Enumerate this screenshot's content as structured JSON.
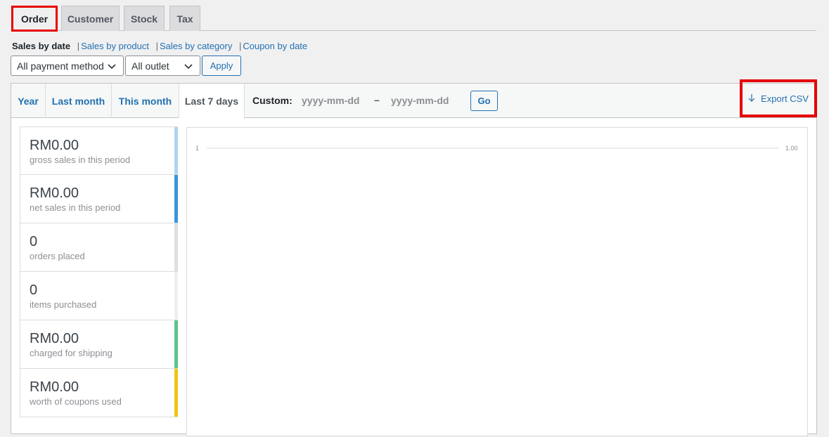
{
  "report_tabs": [
    {
      "label": "Order",
      "active": true
    },
    {
      "label": "Customer"
    },
    {
      "label": "Stock"
    },
    {
      "label": "Tax"
    }
  ],
  "sub_nav": {
    "current": "Sales by date",
    "links": [
      "Sales by product",
      "Sales by category",
      "Coupon by date"
    ]
  },
  "filters": {
    "payment_method": "All payment method",
    "outlet": "All outlet",
    "apply_label": "Apply"
  },
  "range": {
    "items": [
      "Year",
      "Last month",
      "This month",
      "Last 7 days"
    ],
    "active": "Last 7 days",
    "custom_label": "Custom:",
    "date_placeholder": "yyyy-mm-dd",
    "dash": "–",
    "go_label": "Go",
    "export_label": "Export CSV"
  },
  "legend": [
    {
      "value": "RM0.00",
      "label": "gross sales in this period",
      "color": "#b1d4ea"
    },
    {
      "value": "RM0.00",
      "label": "net sales in this period",
      "color": "#3498db"
    },
    {
      "value": "0",
      "label": "orders placed",
      "color": "#dbe1e3"
    },
    {
      "value": "0",
      "label": "items purchased",
      "color": "#ecf0f1"
    },
    {
      "value": "RM0.00",
      "label": "charged for shipping",
      "color": "#5cc488"
    },
    {
      "value": "RM0.00",
      "label": "worth of coupons used",
      "color": "#f1c40f"
    }
  ],
  "chart_data": {
    "type": "line",
    "left_tick": "1",
    "right_tick": "1.00",
    "series": []
  }
}
